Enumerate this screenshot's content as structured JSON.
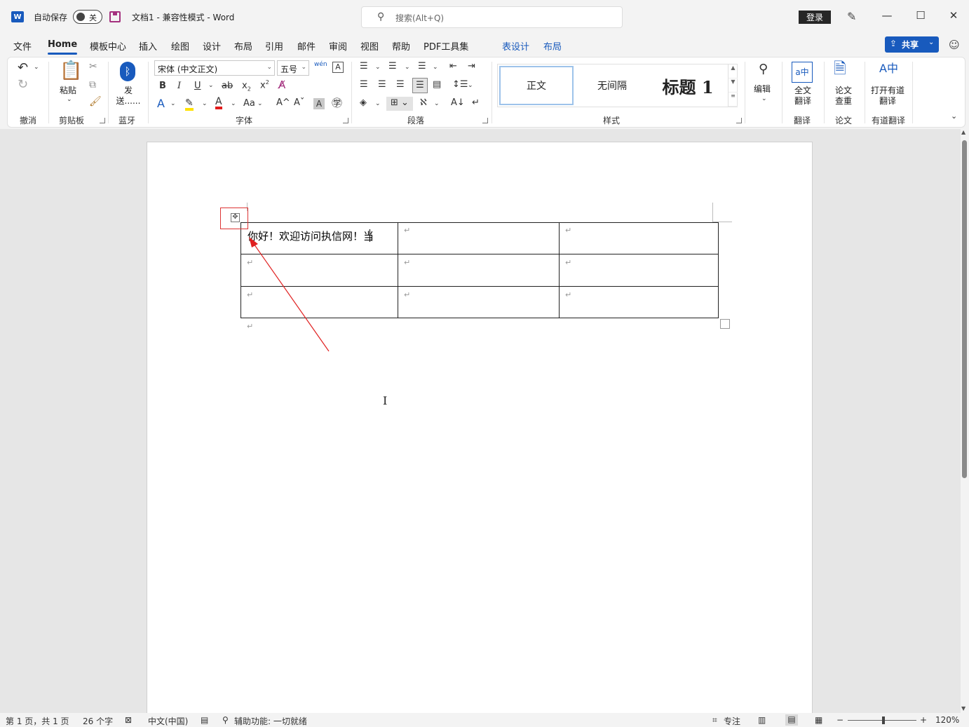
{
  "titlebar": {
    "word_icon": "W",
    "autosave_label": "自动保存",
    "autosave_state": "关",
    "doc_title": "文档1  -  兼容性模式  -  Word",
    "search_placeholder": "搜索(Alt+Q)",
    "login_label": "登录",
    "minimize": "—",
    "maximize": "☐",
    "close": "✕"
  },
  "menu": {
    "tabs": [
      {
        "label": "文件"
      },
      {
        "label": "Home"
      },
      {
        "label": "模板中心"
      },
      {
        "label": "插入"
      },
      {
        "label": "绘图"
      },
      {
        "label": "设计"
      },
      {
        "label": "布局"
      },
      {
        "label": "引用"
      },
      {
        "label": "邮件"
      },
      {
        "label": "审阅"
      },
      {
        "label": "视图"
      },
      {
        "label": "帮助"
      },
      {
        "label": "PDF工具集"
      },
      {
        "label": "表设计"
      },
      {
        "label": "布局"
      }
    ],
    "share_label": "共享"
  },
  "ribbon": {
    "undo_group": "撤消",
    "clipboard": {
      "paste": "粘贴",
      "label": "剪贴板"
    },
    "bluetooth": {
      "send": "发送......",
      "label": "蓝牙"
    },
    "font": {
      "name": "宋体 (中文正文)",
      "size": "五号",
      "label": "字体"
    },
    "paragraph": {
      "label": "段落"
    },
    "styles": {
      "items": [
        "正文",
        "无间隔",
        "标题 1"
      ],
      "label": "样式"
    },
    "editing": {
      "label": "编辑"
    },
    "translate": {
      "full": "全文翻译",
      "label": "翻译"
    },
    "paper": {
      "check": "论文查重",
      "label": "论文"
    },
    "youdao": {
      "open": "打开有道翻译",
      "label": "有道翻译"
    }
  },
  "document": {
    "cell_1_1": "你好！欢迎访问执信网！当",
    "return_mark": "↵"
  },
  "statusbar": {
    "page": "第 1 页，共 1 页",
    "words": "26 个字",
    "language": "中文(中国)",
    "accessibility": "辅助功能: 一切就绪",
    "focus": "专注",
    "zoom": "120%"
  }
}
